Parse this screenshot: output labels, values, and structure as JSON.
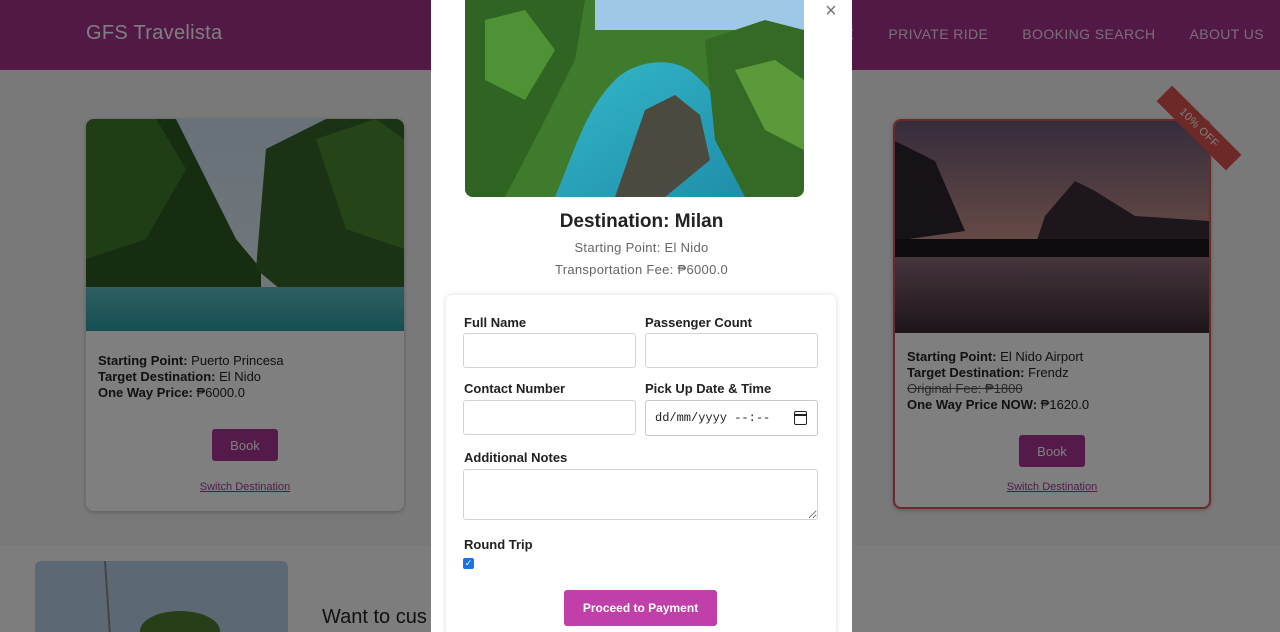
{
  "navbar": {
    "brand": "GFS Travelista",
    "links": [
      "ME",
      "PRIVATE RIDE",
      "BOOKING SEARCH",
      "ABOUT US"
    ]
  },
  "cards": [
    {
      "starting_label": "Starting Point:",
      "starting_value": "Puerto Princesa",
      "target_label": "Target Destination:",
      "target_value": "El Nido",
      "price_label": "One Way Price:",
      "price_value": "₱6000.0",
      "book_label": "Book",
      "switch_label": "Switch Destination"
    },
    {
      "ribbon": "10% OFF",
      "starting_label": "Starting Point:",
      "starting_value": "El Nido Airport",
      "target_label": "Target Destination:",
      "target_value": "Frendz",
      "original_fee": "Original Fee: ₱1800",
      "price_label": "One Way Price NOW:",
      "price_value": "₱1620.0",
      "book_label": "Book",
      "switch_label": "Switch Destination"
    }
  ],
  "section2": {
    "heading": "Want to cus"
  },
  "modal": {
    "close": "×",
    "title": "Destination: Milan",
    "starting_point": "Starting Point: El Nido",
    "fee": "Transportation Fee: ₱6000.0",
    "form": {
      "full_name_label": "Full Name",
      "full_name_value": "",
      "passenger_label": "Passenger Count",
      "passenger_value": "",
      "contact_label": "Contact Number",
      "contact_value": "",
      "pickup_label": "Pick Up Date & Time",
      "pickup_placeholder": "dd/mm/yyyy --:--",
      "notes_label": "Additional Notes",
      "notes_value": "",
      "round_trip_label": "Round Trip",
      "round_trip_checked": true,
      "submit_label": "Proceed to Payment"
    }
  },
  "colors": {
    "brand": "#a5338f",
    "button": "#a93795",
    "pay_button": "#c03fa9",
    "ribbon": "#d9534f"
  }
}
